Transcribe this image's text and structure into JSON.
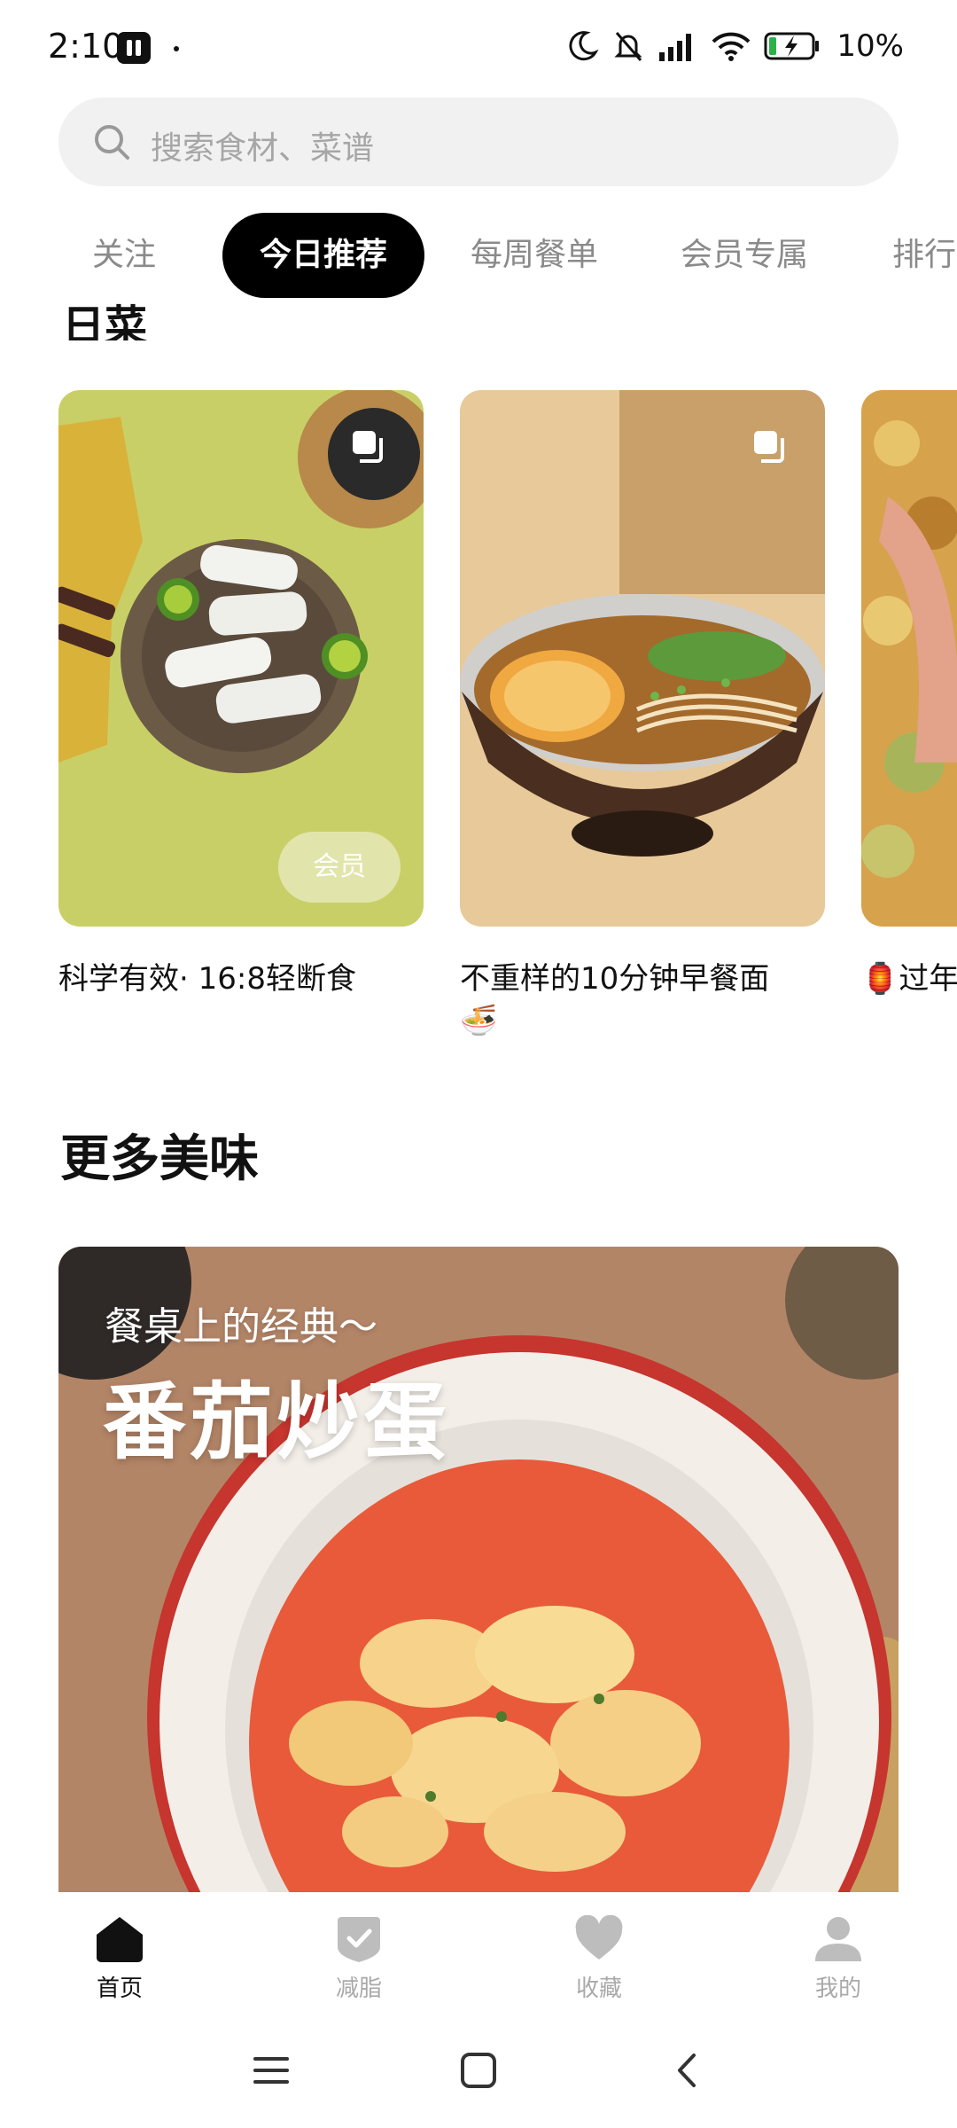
{
  "status_bar": {
    "time": "2:10",
    "battery": "10%"
  },
  "search": {
    "placeholder": "搜索食材、菜谱"
  },
  "tabs": [
    {
      "label": "关注"
    },
    {
      "label": "今日推荐",
      "active": true
    },
    {
      "label": "每周餐单"
    },
    {
      "label": "会员专属"
    },
    {
      "label": "排行"
    }
  ],
  "section_partial_title": "日菜",
  "cards": [
    {
      "title": "科学有效· 16:8轻断食",
      "badge": "会员",
      "icon": "copy-icon"
    },
    {
      "title": "不重样的10分钟早餐面",
      "emoji": "🍜",
      "icon": "copy-icon"
    },
    {
      "title": "🏮过年"
    }
  ],
  "more_section": {
    "title": "更多美味"
  },
  "feature": {
    "subtitle": "餐桌上的经典～",
    "title": "番茄炒蛋"
  },
  "bottom_nav": [
    {
      "label": "首页",
      "icon": "home-icon",
      "active": true
    },
    {
      "label": "减脂",
      "icon": "shield-check-icon"
    },
    {
      "label": "收藏",
      "icon": "heart-icon"
    },
    {
      "label": "我的",
      "icon": "person-icon"
    }
  ],
  "colors": {
    "accent": "#000000",
    "inactive_tab": "#8a8a8a",
    "nav_inactive": "#a9a9a9"
  }
}
